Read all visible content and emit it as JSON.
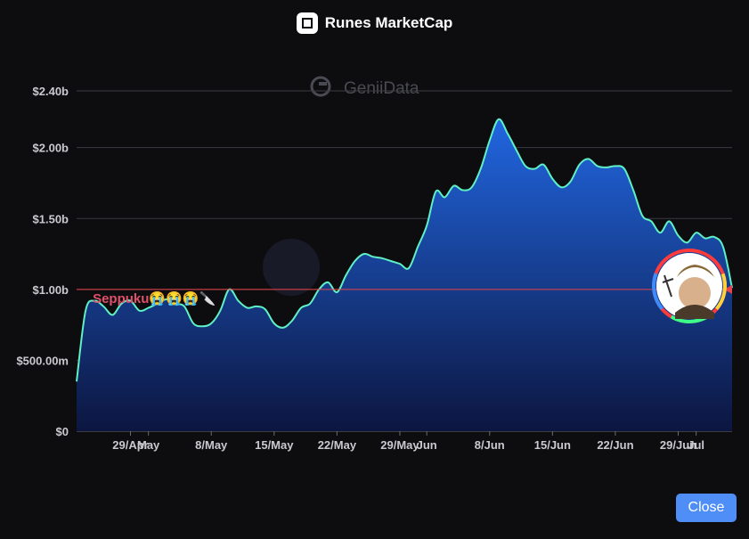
{
  "header": {
    "title": "Runes MarketCap"
  },
  "close_label": "Close",
  "watermark": {
    "text": "GeniiData"
  },
  "colors": {
    "background": "#0d0d10",
    "line": "#5ff0c4",
    "area_top": "#2166e0",
    "area_bottom": "#0c1640",
    "threshold_line": "#e8424a",
    "annotation": "#e0506a",
    "button": "#4f8ef7"
  },
  "avatar": {
    "icon": "user-avatar-icon"
  },
  "chart_data": {
    "type": "area",
    "title": "Runes MarketCap",
    "y_unit": "USD",
    "ylim": [
      0,
      2400000000
    ],
    "y_ticks": [
      {
        "value": 0,
        "label": "$0"
      },
      {
        "value": 500000000,
        "label": "$500.00m"
      },
      {
        "value": 1000000000,
        "label": "$1.00b"
      },
      {
        "value": 1500000000,
        "label": "$1.50b"
      },
      {
        "value": 2000000000,
        "label": "$2.00b"
      },
      {
        "value": 2400000000,
        "label": "$2.40b"
      }
    ],
    "x_ticks": [
      {
        "x": "2024-04-29",
        "label": "29/Apr"
      },
      {
        "x": "2024-05-01",
        "label": "May"
      },
      {
        "x": "2024-05-08",
        "label": "8/May"
      },
      {
        "x": "2024-05-15",
        "label": "15/May"
      },
      {
        "x": "2024-05-22",
        "label": "22/May"
      },
      {
        "x": "2024-05-29",
        "label": "29/May"
      },
      {
        "x": "2024-06-01",
        "label": "Jun"
      },
      {
        "x": "2024-06-08",
        "label": "8/Jun"
      },
      {
        "x": "2024-06-15",
        "label": "15/Jun"
      },
      {
        "x": "2024-06-22",
        "label": "22/Jun"
      },
      {
        "x": "2024-06-29",
        "label": "29/Jun"
      },
      {
        "x": "2024-07-01",
        "label": "Jul"
      }
    ],
    "x_range": [
      "2024-04-23",
      "2024-07-05"
    ],
    "grid": true,
    "legend": "none",
    "threshold": {
      "value": 1000000000
    },
    "annotation": {
      "text": "Seppuku😭😭😭🔪",
      "x": "2024-04-24",
      "y": 880000000
    },
    "series": [
      {
        "points": [
          [
            "2024-04-23",
            350000000
          ],
          [
            "2024-04-24",
            850000000
          ],
          [
            "2024-04-25",
            920000000
          ],
          [
            "2024-04-26",
            880000000
          ],
          [
            "2024-04-27",
            820000000
          ],
          [
            "2024-04-28",
            900000000
          ],
          [
            "2024-04-29",
            920000000
          ],
          [
            "2024-04-30",
            850000000
          ],
          [
            "2024-05-01",
            870000000
          ],
          [
            "2024-05-02",
            900000000
          ],
          [
            "2024-05-03",
            930000000
          ],
          [
            "2024-05-04",
            900000000
          ],
          [
            "2024-05-05",
            880000000
          ],
          [
            "2024-05-06",
            760000000
          ],
          [
            "2024-05-07",
            740000000
          ],
          [
            "2024-05-08",
            760000000
          ],
          [
            "2024-05-09",
            850000000
          ],
          [
            "2024-05-10",
            1000000000
          ],
          [
            "2024-05-11",
            920000000
          ],
          [
            "2024-05-12",
            870000000
          ],
          [
            "2024-05-13",
            880000000
          ],
          [
            "2024-05-14",
            860000000
          ],
          [
            "2024-05-15",
            760000000
          ],
          [
            "2024-05-16",
            730000000
          ],
          [
            "2024-05-17",
            780000000
          ],
          [
            "2024-05-18",
            870000000
          ],
          [
            "2024-05-19",
            900000000
          ],
          [
            "2024-05-20",
            1000000000
          ],
          [
            "2024-05-21",
            1050000000
          ],
          [
            "2024-05-22",
            980000000
          ],
          [
            "2024-05-23",
            1100000000
          ],
          [
            "2024-05-24",
            1200000000
          ],
          [
            "2024-05-25",
            1250000000
          ],
          [
            "2024-05-26",
            1230000000
          ],
          [
            "2024-05-27",
            1220000000
          ],
          [
            "2024-05-28",
            1200000000
          ],
          [
            "2024-05-29",
            1180000000
          ],
          [
            "2024-05-30",
            1150000000
          ],
          [
            "2024-05-31",
            1300000000
          ],
          [
            "2024-06-01",
            1450000000
          ],
          [
            "2024-06-02",
            1690000000
          ],
          [
            "2024-06-03",
            1650000000
          ],
          [
            "2024-06-04",
            1730000000
          ],
          [
            "2024-06-05",
            1700000000
          ],
          [
            "2024-06-06",
            1720000000
          ],
          [
            "2024-06-07",
            1850000000
          ],
          [
            "2024-06-08",
            2050000000
          ],
          [
            "2024-06-09",
            2200000000
          ],
          [
            "2024-06-10",
            2100000000
          ],
          [
            "2024-06-11",
            1980000000
          ],
          [
            "2024-06-12",
            1870000000
          ],
          [
            "2024-06-13",
            1850000000
          ],
          [
            "2024-06-14",
            1880000000
          ],
          [
            "2024-06-15",
            1780000000
          ],
          [
            "2024-06-16",
            1720000000
          ],
          [
            "2024-06-17",
            1760000000
          ],
          [
            "2024-06-18",
            1880000000
          ],
          [
            "2024-06-19",
            1920000000
          ],
          [
            "2024-06-20",
            1870000000
          ],
          [
            "2024-06-21",
            1860000000
          ],
          [
            "2024-06-22",
            1870000000
          ],
          [
            "2024-06-23",
            1850000000
          ],
          [
            "2024-06-24",
            1700000000
          ],
          [
            "2024-06-25",
            1520000000
          ],
          [
            "2024-06-26",
            1480000000
          ],
          [
            "2024-06-27",
            1400000000
          ],
          [
            "2024-06-28",
            1480000000
          ],
          [
            "2024-06-29",
            1380000000
          ],
          [
            "2024-06-30",
            1330000000
          ],
          [
            "2024-07-01",
            1400000000
          ],
          [
            "2024-07-02",
            1360000000
          ],
          [
            "2024-07-03",
            1370000000
          ],
          [
            "2024-07-04",
            1300000000
          ],
          [
            "2024-07-05",
            1010000000
          ]
        ]
      }
    ]
  }
}
